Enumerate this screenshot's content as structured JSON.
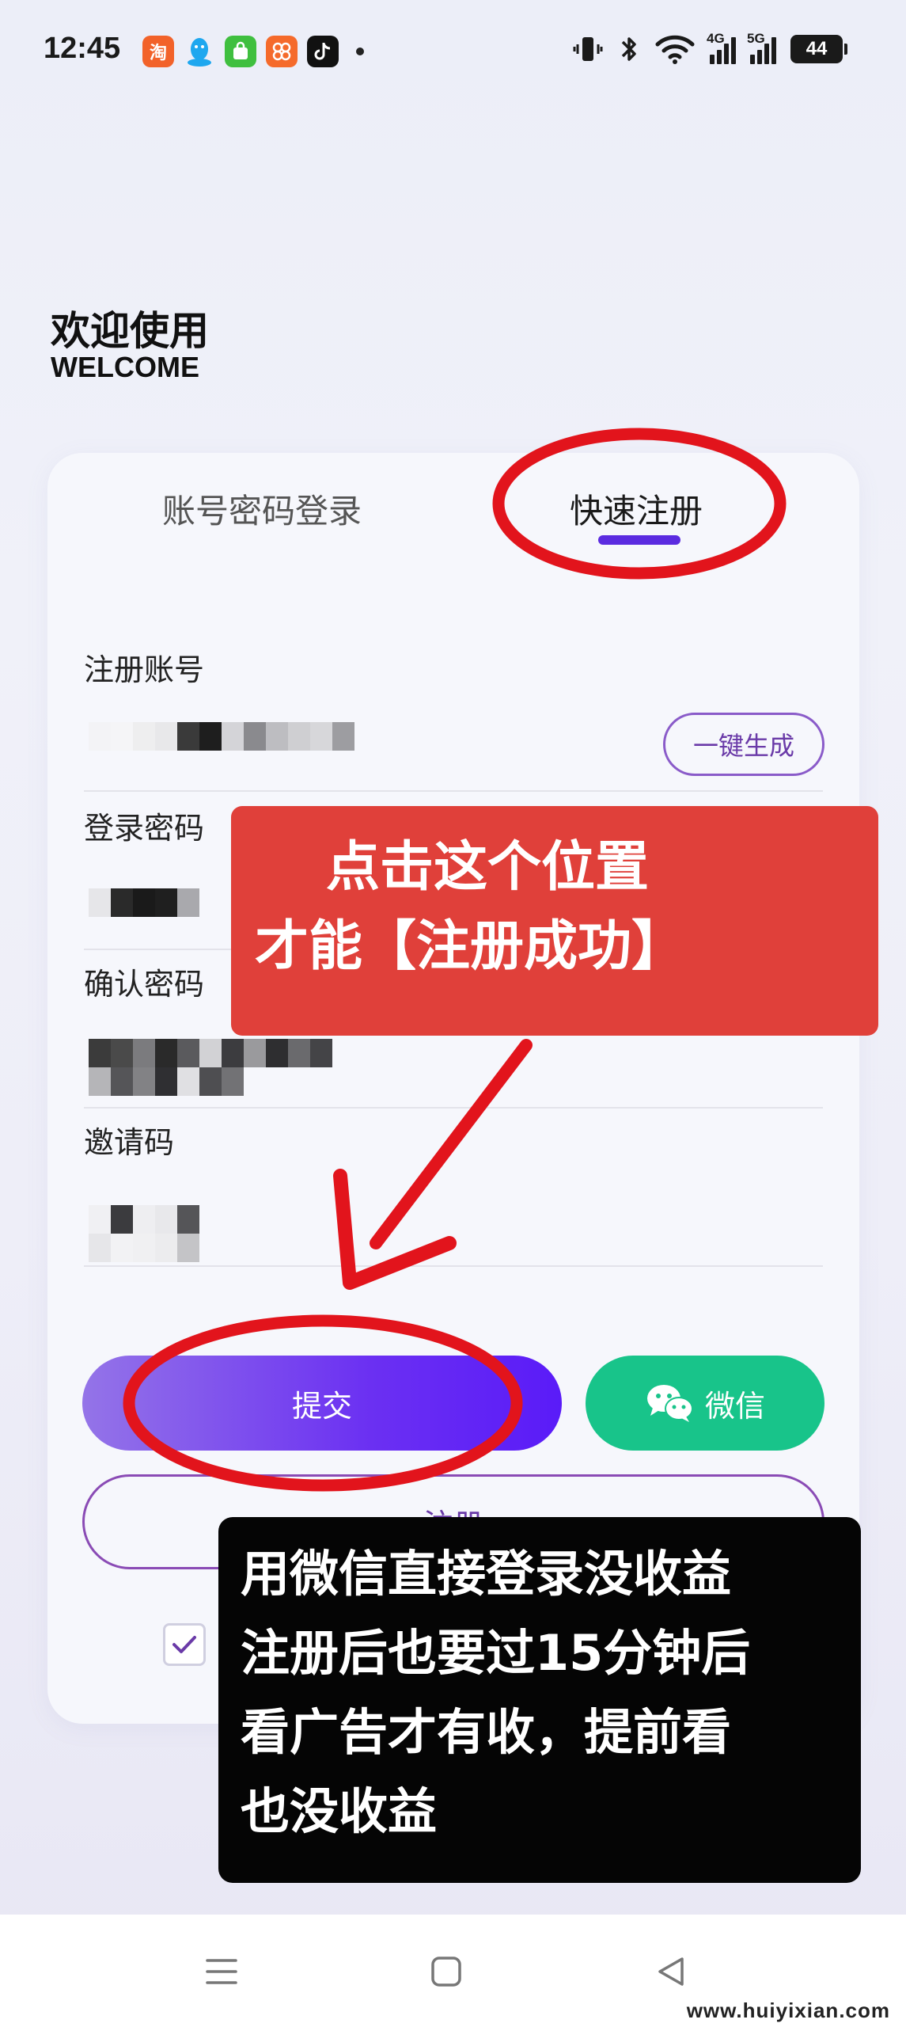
{
  "status_bar": {
    "time": "12:45",
    "app_icons": [
      {
        "name": "taobao-icon",
        "glyph": "淘",
        "color": "#f2622a"
      },
      {
        "name": "qq-icon",
        "glyph": "",
        "color": "#1ea7ef"
      },
      {
        "name": "shopping-bag-icon",
        "glyph": "",
        "color": "#3fbf3f"
      },
      {
        "name": "app-grid-icon",
        "glyph": "",
        "color": "#f56a2b"
      },
      {
        "name": "tiktok-icon",
        "glyph": "",
        "color": "#111111"
      }
    ],
    "signal_1": "4G",
    "signal_2": "5G",
    "battery": "44"
  },
  "header": {
    "title_cn": "欢迎使用",
    "title_en": "WELCOME"
  },
  "tabs": {
    "login": "账号密码登录",
    "register": "快速注册",
    "active_color": "#5b2be0"
  },
  "form": {
    "account_label": "注册账号",
    "generate_label": "一键生成",
    "password_label": "登录密码",
    "confirm_label": "确认密码",
    "invite_label": "邀请码"
  },
  "buttons": {
    "submit": "提交",
    "wechat": "微信",
    "register": "注册"
  },
  "annotations": {
    "red_line_1": "点击这个位置",
    "red_line_2": "才能【注册成功】",
    "black_line_1": "用微信直接登录没收益",
    "black_line_2": "注册后也要过15分钟后",
    "black_line_3": "看广告才有收，提前看",
    "black_line_4": "也没收益",
    "highlight_color": "#e2141c"
  },
  "watermark": "www.huiyixian.com"
}
